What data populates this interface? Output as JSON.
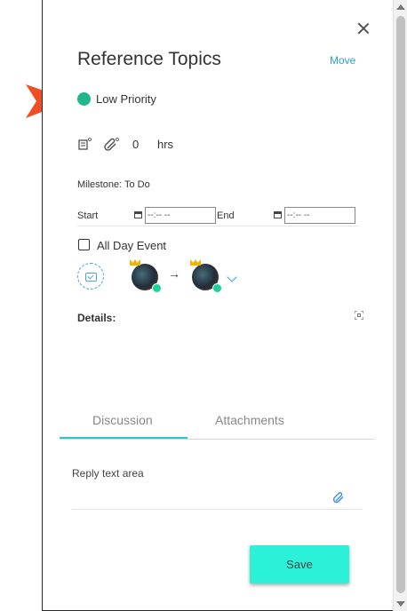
{
  "task": {
    "title": "Reference Topics",
    "move_label": "Move",
    "priority_label": "Low Priority",
    "priority_color": "#20b78c",
    "notes_icon": "notes-icon",
    "attachments_icon": "paperclip-icon",
    "hours_value": "0",
    "hours_unit": "hrs",
    "milestone": "Milestone: To Do",
    "start_label": "Start",
    "start_value": "--:-- --",
    "end_label": "End",
    "end_value": "--:-- --",
    "all_day_label": "All Day Event",
    "all_day_checked": false,
    "details_label": "Details:"
  },
  "tabs": [
    {
      "label": "Discussion",
      "active": true
    },
    {
      "label": "Attachments",
      "active": false
    }
  ],
  "reply": {
    "placeholder": "Reply text area"
  },
  "save_label": "Save",
  "colors": {
    "accent": "#2f9fd8",
    "save_button": "#2af1d8",
    "arrow": "#f04e23"
  }
}
